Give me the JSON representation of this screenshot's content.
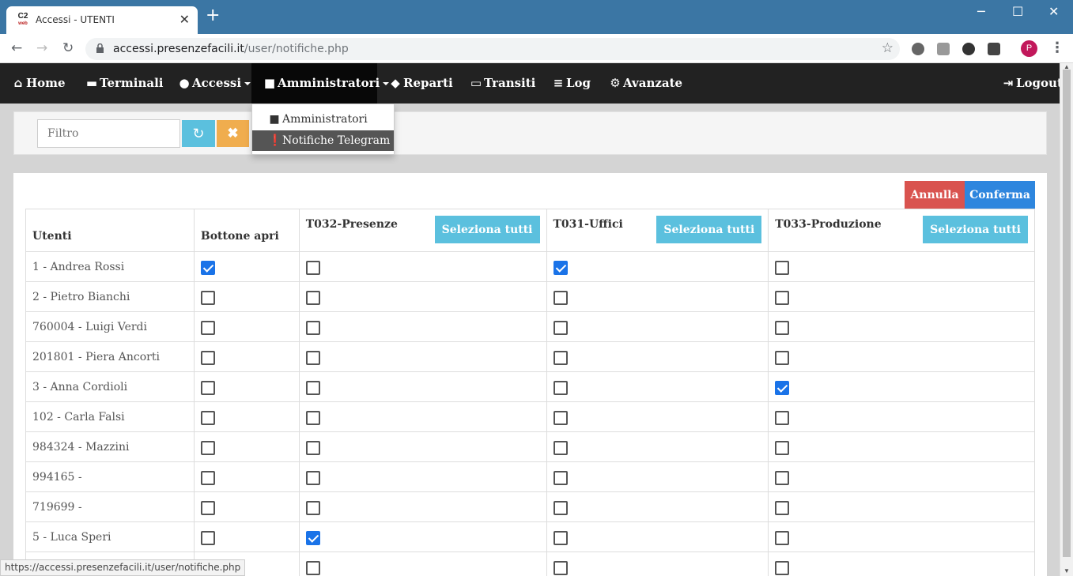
{
  "browser": {
    "tab_title": "Accessi - UTENTI",
    "favicon_text": "C2",
    "favicon_sub": "web",
    "url_host": "accessi.presenzefacili.it",
    "url_path": "/user/notifiche.php",
    "profile_initial": "P",
    "status_url": "https://accessi.presenzefacili.it/user/notifiche.php"
  },
  "navbar": {
    "items": [
      {
        "label": "Home",
        "icon": "home-icon"
      },
      {
        "label": "Terminali",
        "icon": "hdd-icon"
      },
      {
        "label": "Accessi",
        "icon": "user-icon",
        "dropdown": true
      },
      {
        "label": "Amministratori",
        "icon": "lock-icon",
        "dropdown": true,
        "active": true
      },
      {
        "label": "Reparti",
        "icon": "tags-icon"
      },
      {
        "label": "Transiti",
        "icon": "credit-card-icon"
      },
      {
        "label": "Log",
        "icon": "list-icon"
      },
      {
        "label": "Avanzate",
        "icon": "gear-icon"
      }
    ],
    "logout_label": "Logout"
  },
  "dropdown": {
    "items": [
      {
        "label": "Amministratori",
        "icon": "lock-icon"
      },
      {
        "label": "Notifiche Telegram",
        "icon": "exclamation-icon",
        "selected": true
      }
    ]
  },
  "filter": {
    "placeholder": "Filtro"
  },
  "actions": {
    "annulla_label": "Annulla",
    "conferma_label": "Conferma"
  },
  "table": {
    "headers": {
      "utenti": "Utenti",
      "bottone": "Bottone apri",
      "t032": "T032-Presenze",
      "t031": "T031-Uffici",
      "t033": "T033-Produzione",
      "select_all": "Seleziona tutti"
    },
    "rows": [
      {
        "name": "1 - Andrea Rossi",
        "checks": [
          true,
          false,
          true,
          false
        ]
      },
      {
        "name": "2 - Pietro Bianchi",
        "checks": [
          false,
          false,
          false,
          false
        ]
      },
      {
        "name": "760004 - Luigi Verdi",
        "checks": [
          false,
          false,
          false,
          false
        ]
      },
      {
        "name": "201801 - Piera Ancorti",
        "checks": [
          false,
          false,
          false,
          false
        ]
      },
      {
        "name": "3 - Anna Cordioli",
        "checks": [
          false,
          false,
          false,
          true
        ]
      },
      {
        "name": "102 - Carla Falsi",
        "checks": [
          false,
          false,
          false,
          false
        ]
      },
      {
        "name": "984324 - Mazzini",
        "checks": [
          false,
          false,
          false,
          false
        ]
      },
      {
        "name": "994165 -",
        "checks": [
          false,
          false,
          false,
          false
        ]
      },
      {
        "name": "719699 -",
        "checks": [
          false,
          false,
          false,
          false
        ]
      },
      {
        "name": "5 - Luca Speri",
        "checks": [
          false,
          true,
          false,
          false
        ]
      },
      {
        "name": "",
        "checks": [
          false,
          false,
          false,
          false
        ]
      }
    ]
  },
  "colors": {
    "navbar_bg": "#222222",
    "info": "#5bc0de",
    "warning": "#f0ad4e",
    "danger": "#d9534f",
    "primary": "#2e86de",
    "checkbox_on": "#1a73e8"
  }
}
